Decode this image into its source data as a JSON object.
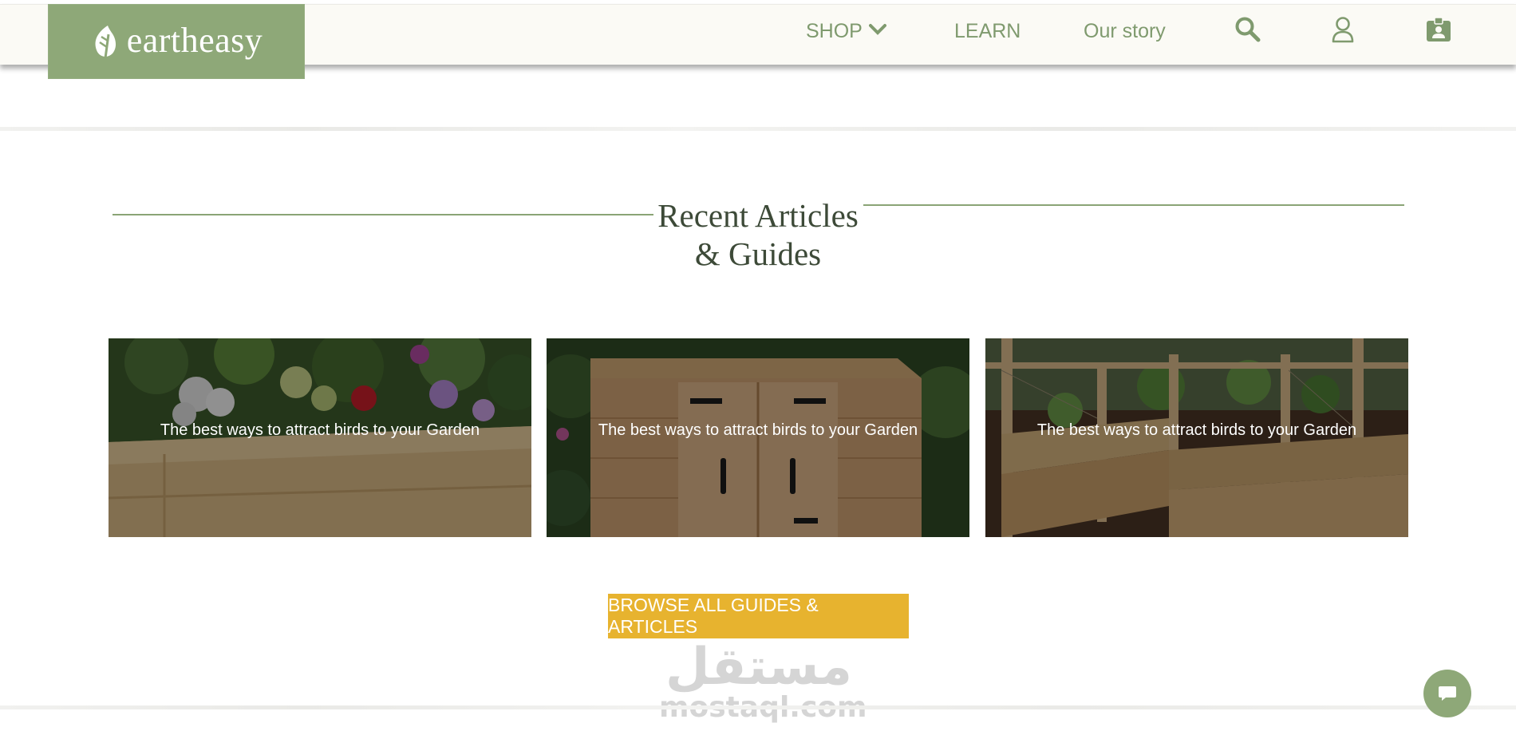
{
  "brand": {
    "name": "eartheasy",
    "logo_icon": "leaf-icon"
  },
  "nav": {
    "shop": "SHOP",
    "learn": "LEARN",
    "our_story": "Our story",
    "icons": [
      "search-icon",
      "user-icon",
      "account-card-icon"
    ]
  },
  "section": {
    "title_line1": "Recent Articles",
    "title_line2": "& Guides"
  },
  "articles": [
    {
      "title": "The best ways to attract birds to your Garden",
      "image": "raised-planter-with-flowers"
    },
    {
      "title": "The best ways to attract birds to your Garden",
      "image": "wooden-garden-shed"
    },
    {
      "title": "The best ways to attract birds to your Garden",
      "image": "fenced-raised-garden-bed"
    }
  ],
  "cta": {
    "label": "BROWSE ALL GUIDES & ARTICLES"
  },
  "watermark": {
    "arabic": "مستقل",
    "latin": "mostaql.com"
  },
  "chat": {
    "icon": "chat-bubble-icon"
  },
  "colors": {
    "brand_green": "#8ea878",
    "nav_text": "#7f9a6e",
    "heading_text": "#3d4a38",
    "cta_yellow": "#e7b32f",
    "header_bg": "#fbfaf5"
  }
}
